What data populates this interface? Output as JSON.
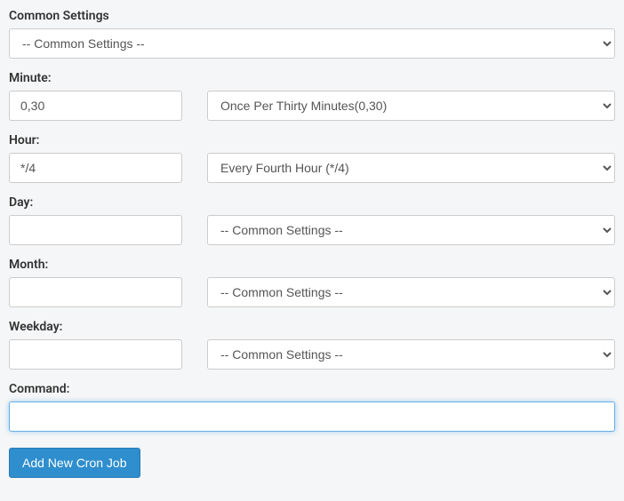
{
  "common_settings": {
    "label": "Common Settings",
    "selected": "-- Common Settings --"
  },
  "minute": {
    "label": "Minute:",
    "value": "0,30",
    "selected": "Once Per Thirty Minutes(0,30)"
  },
  "hour": {
    "label": "Hour:",
    "value": "*/4",
    "selected": "Every Fourth Hour (*/4)"
  },
  "day": {
    "label": "Day:",
    "value": "",
    "selected": "-- Common Settings --"
  },
  "month": {
    "label": "Month:",
    "value": "",
    "selected": "-- Common Settings --"
  },
  "weekday": {
    "label": "Weekday:",
    "value": "",
    "selected": "-- Common Settings --"
  },
  "command": {
    "label": "Command:",
    "value": ""
  },
  "submit": {
    "label": "Add New Cron Job"
  }
}
